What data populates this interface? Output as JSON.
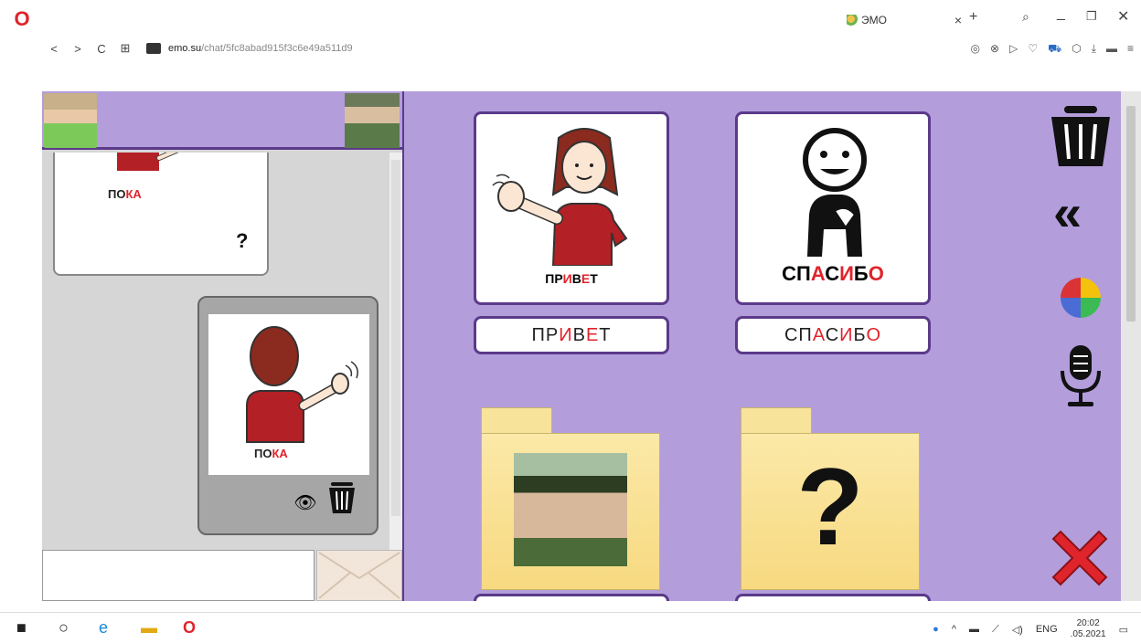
{
  "browser": {
    "tab_title": "ЭМО",
    "tab_close": "×",
    "new_tab": "+",
    "url_host": "emo.su",
    "url_path": "/chat/5fc8abad915f3c6e49a511d9",
    "nav": {
      "back": "<",
      "forward": ">",
      "reload": "C",
      "grid": "⊞"
    }
  },
  "chat": {
    "incoming_caption_plain": "ПО",
    "incoming_caption_red": "КА",
    "incoming_mark": "?",
    "outgoing_caption_plain": "ПО",
    "outgoing_caption_red": "КА"
  },
  "board": {
    "cards": [
      {
        "caption_parts": [
          "ПР",
          "И",
          "В",
          "Е",
          "Т"
        ],
        "word_parts": [
          "ПР",
          "И",
          "В",
          "Е",
          "Т"
        ]
      },
      {
        "caption_parts": [
          "СП",
          "А",
          "С",
          "И",
          "Б",
          "О"
        ],
        "word_parts": [
          "СП",
          "А",
          "С",
          "И",
          "Б",
          "О"
        ]
      }
    ],
    "folder_question": "?"
  },
  "taskbar": {
    "lang": "ENG",
    "time": "20:02",
    "date": ".05.2021"
  },
  "colors": {
    "accent_purple": "#b39ddb",
    "border_purple": "#5b3a8a",
    "highlight_red": "#e0242b"
  }
}
